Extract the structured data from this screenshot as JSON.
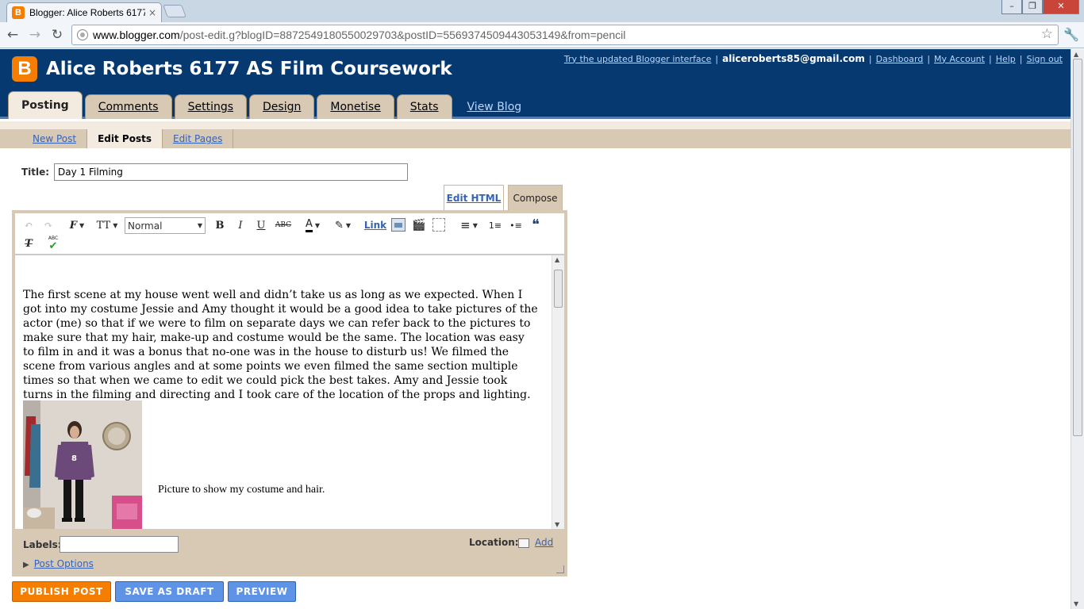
{
  "browser": {
    "tab_title": "Blogger: Alice Roberts 6177 ...",
    "tab_close": "×",
    "url_host": "www.blogger.com",
    "url_path": "/post-edit.g?blogID=8872549180550029703&postID=5569374509443053149&from=pencil",
    "back_icon": "←",
    "forward_icon": "→",
    "reload_icon": "↻",
    "star_icon": "☆",
    "wrench_icon": "🔧",
    "minimize_icon": "–",
    "maximize_icon": "❐",
    "close_icon": "✕"
  },
  "header": {
    "logo_letter": "B",
    "blog_title": "Alice Roberts 6177 AS Film Coursework",
    "links": {
      "try_updated": "Try the updated Blogger interface",
      "email": "aliceroberts85@gmail.com",
      "dashboard": "Dashboard",
      "my_account": "My Account",
      "help": "Help",
      "sign_out": "Sign out"
    },
    "separator": "|"
  },
  "main_tabs": [
    {
      "label": "Posting"
    },
    {
      "label": "Comments"
    },
    {
      "label": "Settings"
    },
    {
      "label": "Design"
    },
    {
      "label": "Monetise"
    },
    {
      "label": "Stats"
    }
  ],
  "view_blog": "View Blog",
  "sub_tabs": [
    {
      "label": "New Post"
    },
    {
      "label": "Edit Posts"
    },
    {
      "label": "Edit Pages"
    }
  ],
  "post": {
    "title_label": "Title:",
    "title_value": "Day 1 Filming",
    "edit_html_tab": "Edit HTML",
    "compose_tab": "Compose",
    "body_text": "The first scene at my house went well and didn’t take us as long as we expected. When I got into my costume Jessie and Amy thought it would be a good idea to take pictures of the actor (me) so that if we were to film on separate days we can refer back to the pictures to make sure that my hair, make-up and costume would be the same. The location was easy to film in and it was a bonus that no-one was in the house to disturb us! We filmed the scene from various angles and at some points we even filmed the same section multiple times so that when we came to edit we could pick the best takes. Amy and Jessie took turns in the filming and directing and I took care of the location of the props and lighting.",
    "image_caption": "Picture to show my costume and hair."
  },
  "editor_toolbar": {
    "undo_icon": "↶",
    "redo_icon": "↷",
    "font_icon": "F",
    "font_size_icon": "TT",
    "format_select_value": "Normal",
    "bold_icon": "B",
    "italic_icon": "I",
    "underline_icon": "U",
    "strike_icon": "ABC",
    "text_color_icon": "A",
    "highlight_icon": "✎",
    "link_label": "Link",
    "align_icon": "≡",
    "numbered_list_icon": "1≡",
    "bullet_list_icon": "•≡",
    "quote_icon": "❝",
    "clear_format_icon": "T",
    "spellcheck_label": "ABC",
    "spellcheck_icon": "✔"
  },
  "footer": {
    "labels_label": "Labels:",
    "labels_value": "",
    "location_label": "Location:",
    "add_label": "Add",
    "post_options": "Post Options",
    "post_options_icon": "▶"
  },
  "actions": {
    "publish": "PUBLISH POST",
    "save_draft": "SAVE AS DRAFT",
    "preview": "PREVIEW"
  },
  "colors": {
    "header_bg": "#063970",
    "tab_bg": "#d8c9b4",
    "publish_orange": "#f57d00",
    "button_blue": "#5f93e6",
    "link_blue": "#3463b8"
  }
}
